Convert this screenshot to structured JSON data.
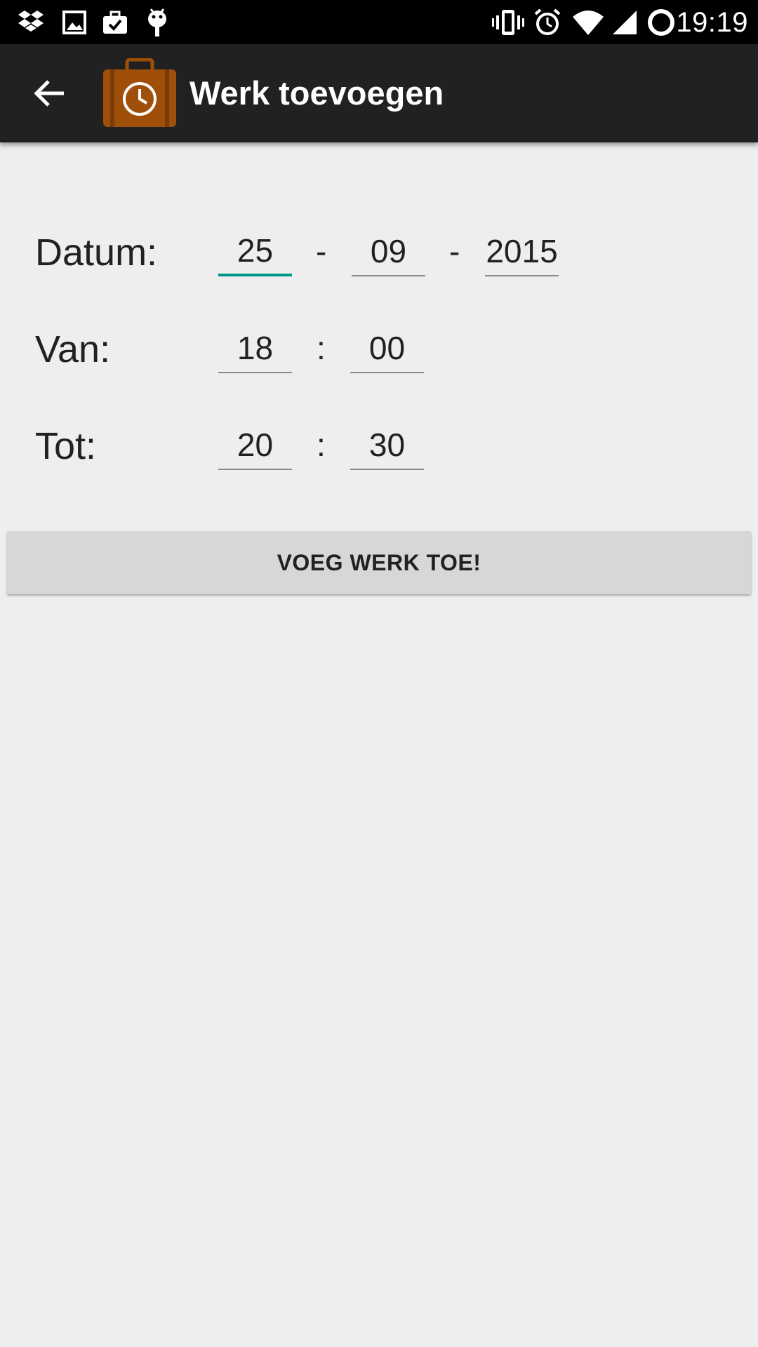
{
  "status_bar": {
    "time": "19:19",
    "left_icons": [
      "dropbox-icon",
      "image-icon",
      "briefcase-check-icon",
      "android-debug-icon"
    ],
    "right_icons": [
      "vibrate-icon",
      "alarm-icon",
      "wifi-icon",
      "cell-signal-icon",
      "battery-charging-icon"
    ]
  },
  "toolbar": {
    "back_icon": "arrow-back-icon",
    "logo_icon": "briefcase-clock-icon",
    "title": "Werk toevoegen",
    "background": "#212121"
  },
  "form": {
    "datum": {
      "label": "Datum:",
      "day": "25",
      "month": "09",
      "year": "2015",
      "separator": "-"
    },
    "van": {
      "label": "Van:",
      "hour": "18",
      "minute": "00",
      "separator": ":"
    },
    "tot": {
      "label": "Tot:",
      "hour": "20",
      "minute": "30",
      "separator": ":"
    }
  },
  "add_button": {
    "label": "VOEG WERK TOE!"
  },
  "colors": {
    "accent": "#009688",
    "logo_brown": "#a04f0a",
    "background": "#eeeeee",
    "button": "#d6d7d7"
  }
}
